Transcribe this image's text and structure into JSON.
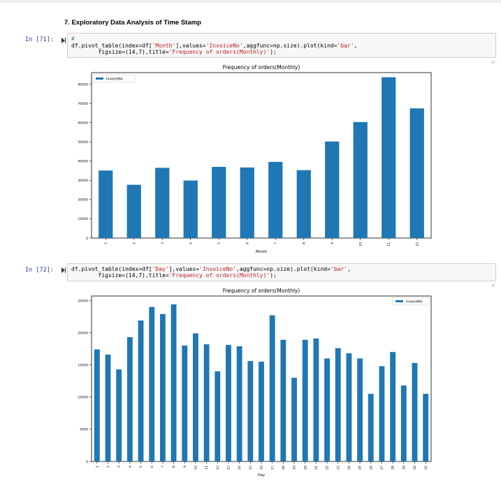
{
  "section_heading": "7. Exploratory Data Analysis of Time Stamp",
  "cells": [
    {
      "prompt": "In [71]:",
      "code_lines": [
        [
          {
            "t": "#",
            "c": "cm-comment"
          }
        ],
        [
          {
            "t": "df.pivot_table(index=df[",
            "c": "cm-op"
          },
          {
            "t": "'Month'",
            "c": "cm-str"
          },
          {
            "t": "],values=",
            "c": "cm-op"
          },
          {
            "t": "'InvoiceNo'",
            "c": "cm-str"
          },
          {
            "t": ",aggfunc=np.size).plot(kind=",
            "c": "cm-op"
          },
          {
            "t": "'bar'",
            "c": "cm-str"
          },
          {
            "t": ",",
            "c": "cm-op"
          }
        ],
        [
          {
            "t": "        figsize=(14,7),title=",
            "c": "cm-op"
          },
          {
            "t": "'Frequency of orders(Monthly)'",
            "c": "cm-str"
          },
          {
            "t": ");",
            "c": "cm-op"
          }
        ]
      ]
    },
    {
      "prompt": "In [72]:",
      "code_lines": [
        [
          {
            "t": "df.pivot_table(index=df[",
            "c": "cm-op"
          },
          {
            "t": "'Day'",
            "c": "cm-str"
          },
          {
            "t": "],values=",
            "c": "cm-op"
          },
          {
            "t": "'InvoiceNo'",
            "c": "cm-str"
          },
          {
            "t": ",aggfunc=np.size).plot(kind=",
            "c": "cm-op"
          },
          {
            "t": "'bar'",
            "c": "cm-str"
          },
          {
            "t": ",",
            "c": "cm-op"
          }
        ],
        [
          {
            "t": "        figsize=(14,7),title=",
            "c": "cm-op"
          },
          {
            "t": "'Frequency of orders(Monthly)'",
            "c": "cm-str"
          },
          {
            "t": ");",
            "c": "cm-op"
          }
        ]
      ]
    }
  ],
  "colors": {
    "bar": "#1f77b4",
    "prompt": "#303f9f"
  },
  "icons": {
    "run": "run-arrow-icon",
    "resize": "resize-handle-icon"
  },
  "chart_data": [
    {
      "type": "bar",
      "title": "Frequency of orders(Monthly)",
      "xlabel": "Month",
      "ylabel": "",
      "categories": [
        "1",
        "2",
        "3",
        "4",
        "5",
        "6",
        "7",
        "8",
        "9",
        "10",
        "11",
        "12"
      ],
      "series": [
        {
          "name": "InvoiceNo",
          "values": [
            35100,
            27700,
            36500,
            29900,
            37000,
            36700,
            39600,
            35300,
            50200,
            60300,
            83600,
            67400
          ]
        }
      ],
      "ylim": [
        0,
        86000
      ],
      "yticks": [
        0,
        10000,
        20000,
        30000,
        40000,
        50000,
        60000,
        70000,
        80000
      ],
      "legend_position": "top-left",
      "grid": false
    },
    {
      "type": "bar",
      "title": "Frequency of orders(Monthly)",
      "xlabel": "Day",
      "ylabel": "",
      "categories": [
        "1",
        "2",
        "3",
        "4",
        "5",
        "6",
        "7",
        "8",
        "9",
        "10",
        "11",
        "12",
        "13",
        "14",
        "15",
        "16",
        "17",
        "18",
        "19",
        "20",
        "21",
        "22",
        "23",
        "24",
        "25",
        "26",
        "27",
        "28",
        "29",
        "30",
        "31"
      ],
      "series": [
        {
          "name": "InvoiceNo",
          "values": [
            17400,
            16600,
            14300,
            19300,
            21900,
            24000,
            22900,
            24400,
            18000,
            19900,
            18200,
            14000,
            18100,
            17900,
            15600,
            15500,
            22700,
            18900,
            13000,
            18900,
            19100,
            16000,
            17600,
            16800,
            16000,
            10500,
            14800,
            17000,
            11800,
            15300,
            10500
          ]
        }
      ],
      "ylim": [
        0,
        25700
      ],
      "yticks": [
        0,
        5000,
        10000,
        15000,
        20000,
        25000
      ],
      "legend_position": "top-right",
      "grid": false
    }
  ]
}
